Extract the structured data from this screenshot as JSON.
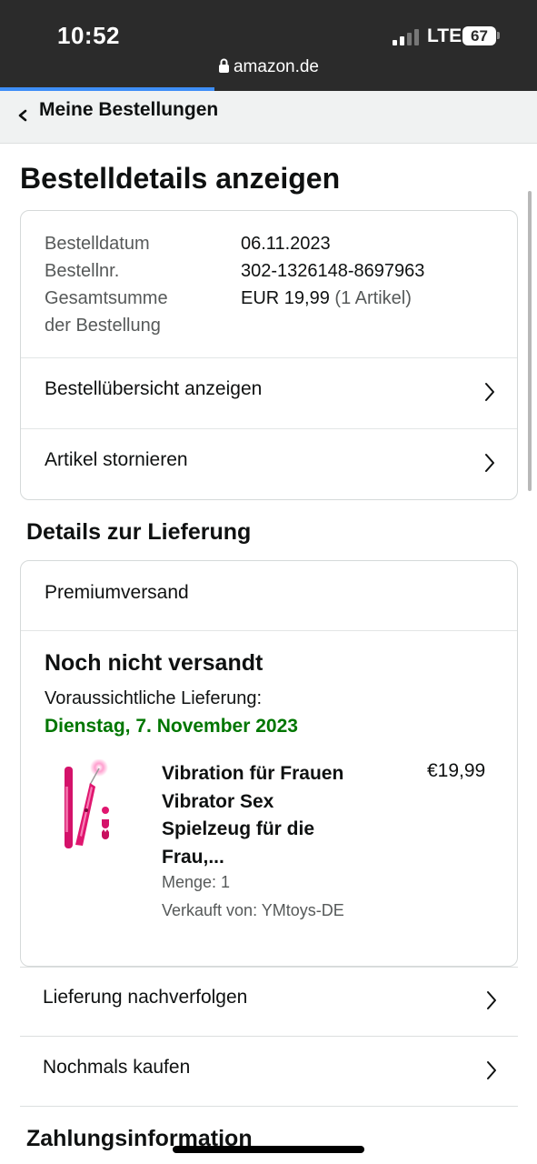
{
  "status_bar": {
    "time": "10:52",
    "network": "LTE",
    "battery": "67",
    "url": "amazon.de",
    "page_load_progress": 0.4
  },
  "nav": {
    "back_label": "Meine Bestellungen"
  },
  "page_title": "Bestelldetails anzeigen",
  "order_summary": {
    "date_label": "Bestelldatum",
    "date_value": "06.11.2023",
    "number_label": "Bestellnr.",
    "number_value": "302-1326148-8697963",
    "total_label_line1": "Gesamtsumme",
    "total_label_line2": "der Bestellung",
    "total_value": "EUR 19,99",
    "total_items": "(1 Artikel)",
    "view_summary_label": "Bestellübersicht anzeigen",
    "cancel_label": "Artikel stornieren"
  },
  "delivery": {
    "section_title": "Details zur Lieferung",
    "shipping_type": "Premiumversand",
    "status": "Noch nicht versandt",
    "estimate_label": "Voraussichtliche Lieferung:",
    "estimate_date": "Dienstag, 7. November 2023",
    "item": {
      "title_lines": [
        "Vibration für Frauen",
        "Vibrator Sex",
        "Spielzeug für die",
        "Frau,..."
      ],
      "price": "€19,99",
      "quantity": "Menge: 1",
      "seller": "Verkauft von: YMtoys-DE"
    },
    "track_label": "Lieferung nachverfolgen",
    "buy_again_label": "Nochmals kaufen"
  },
  "payment": {
    "section_title": "Zahlungsinformation"
  },
  "colors": {
    "status_bar_bg": "#2b2b2b",
    "progress": "#3e8ef7",
    "delivery_date_green": "#007600",
    "product_pink": "#e0166f"
  },
  "icons": [
    "lock-icon",
    "back-chevron-icon",
    "chevron-right-icon",
    "signal-icon",
    "battery-icon"
  ]
}
